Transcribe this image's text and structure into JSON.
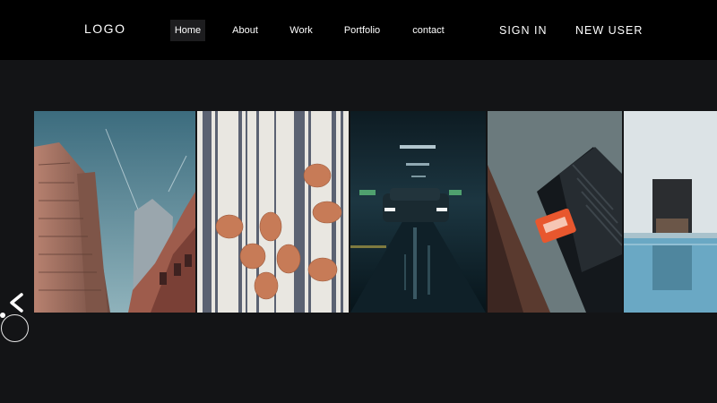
{
  "header": {
    "logo": "LOGO",
    "nav": [
      {
        "label": "Home",
        "active": true
      },
      {
        "label": "About",
        "active": false
      },
      {
        "label": "Work",
        "active": false
      },
      {
        "label": "Portfolio",
        "active": false
      },
      {
        "label": "contact",
        "active": false
      }
    ],
    "sign_in": "SIGN IN",
    "new_user": "NEW USER"
  },
  "gallery": {
    "photos": [
      {
        "subject": "skyscrapers"
      },
      {
        "subject": "brown eggs on striped cloth"
      },
      {
        "subject": "car in parking garage"
      },
      {
        "subject": "red sticker on dark device"
      },
      {
        "subject": "swimming pool"
      }
    ],
    "prev_icon": "chevron-left-icon"
  },
  "colors": {
    "header_bg": "#000000",
    "page_bg": "#131416",
    "active_nav_bg": "#1d1d1f",
    "text": "#ffffff"
  }
}
